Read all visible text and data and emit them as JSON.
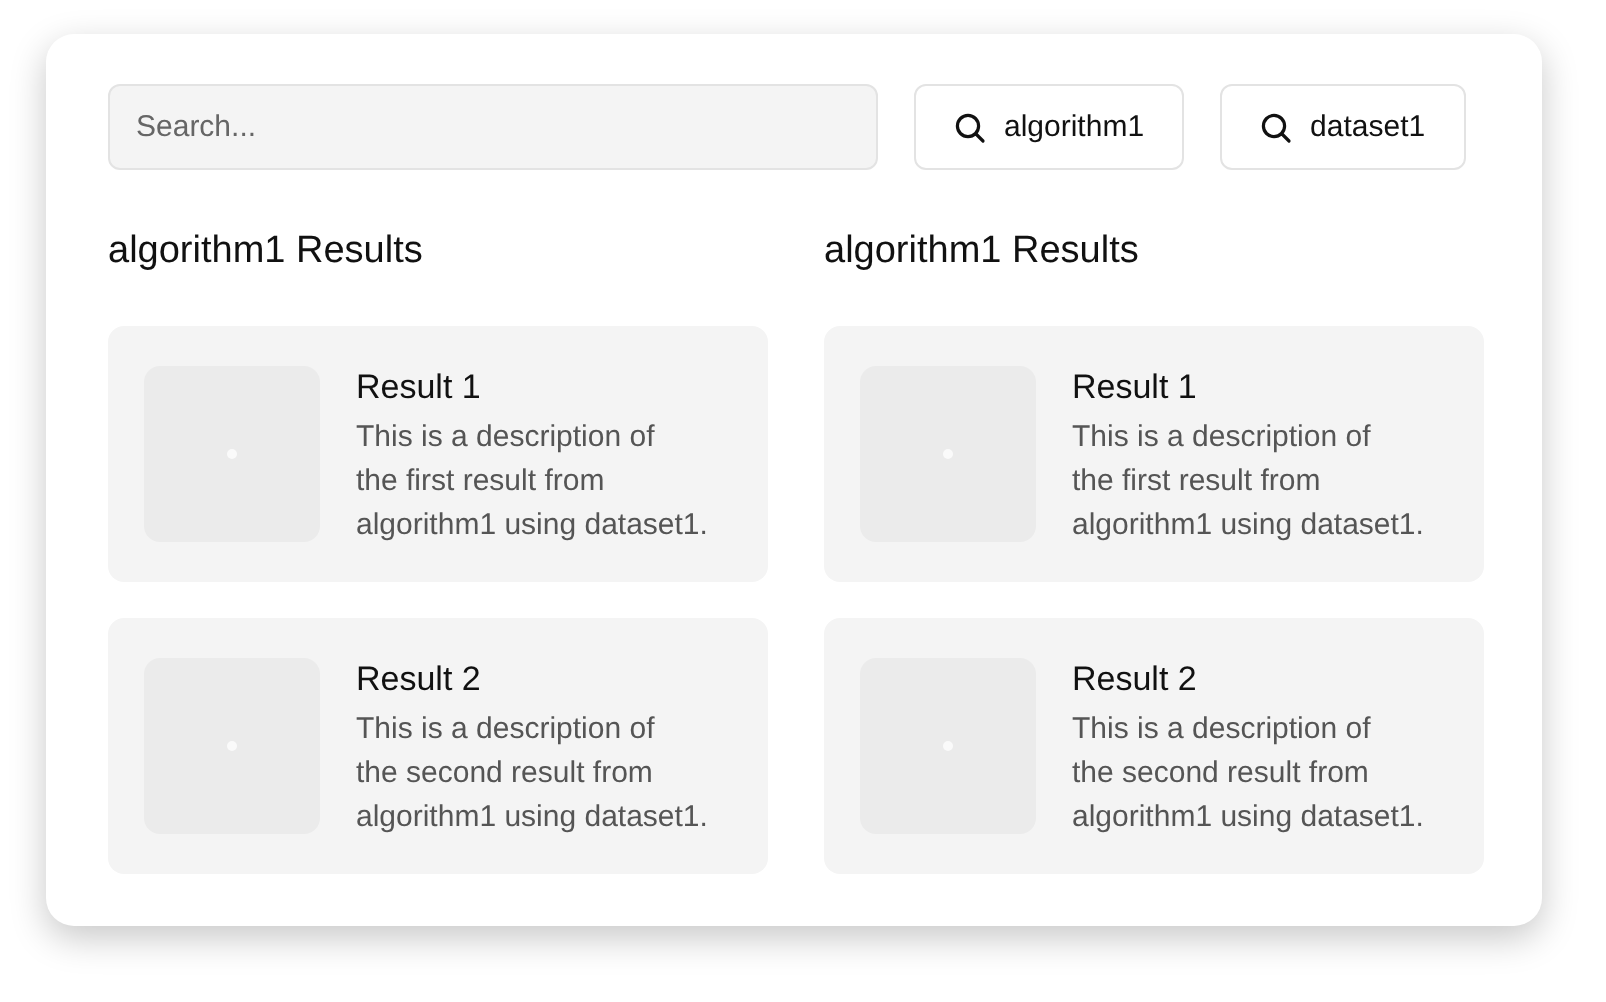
{
  "search": {
    "placeholder": "Search..."
  },
  "filters": [
    {
      "label": "algorithm1"
    },
    {
      "label": "dataset1"
    }
  ],
  "columns": [
    {
      "heading": "algorithm1 Results",
      "results": [
        {
          "title": "Result 1",
          "description": "This is a description of\nthe first result from\nalgorithm1 using dataset1."
        },
        {
          "title": "Result 2",
          "description": "This is a description of\nthe second result from\nalgorithm1 using dataset1."
        }
      ]
    },
    {
      "heading": "algorithm1 Results",
      "results": [
        {
          "title": "Result 1",
          "description": "This is a description of\nthe first result from\nalgorithm1 using dataset1."
        },
        {
          "title": "Result 2",
          "description": "This is a description of\nthe second result from\nalgorithm1 using dataset1."
        }
      ]
    }
  ]
}
